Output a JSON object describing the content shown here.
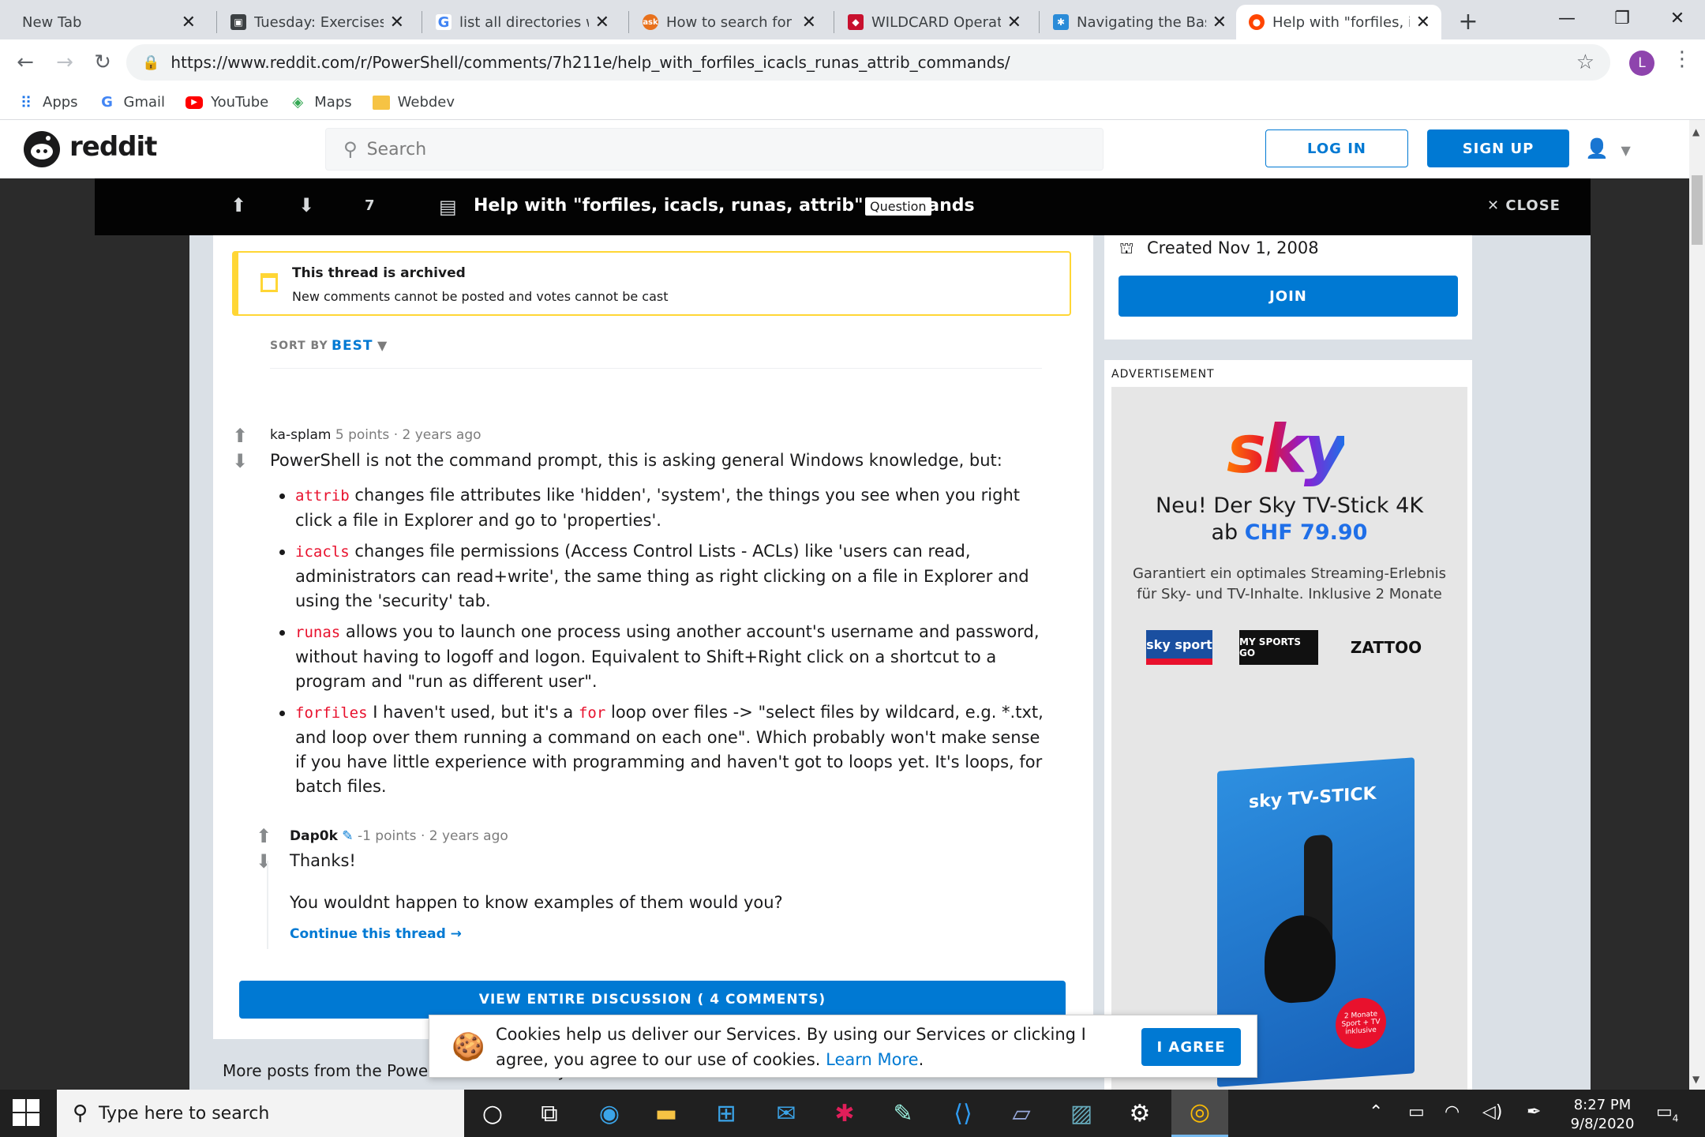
{
  "browser": {
    "tabs": [
      {
        "title": "New Tab",
        "icon": "none",
        "color": ""
      },
      {
        "title": "Tuesday: Exercises C",
        "icon": "doc-icon",
        "color": "#3c4043"
      },
      {
        "title": "list all directories wit",
        "icon": "google-icon",
        "color": "#4285f4"
      },
      {
        "title": "How to search for all",
        "icon": "ask-icon",
        "color": "#e8711c"
      },
      {
        "title": "WILDCARD Operato",
        "icon": "wildcard-icon",
        "color": "#c8102e"
      },
      {
        "title": "Navigating the Bash",
        "icon": "bash-icon",
        "color": "#2a8bd8"
      },
      {
        "title": "Help with \"forfiles, ic",
        "icon": "reddit-icon",
        "color": "#ff4500"
      }
    ],
    "url": "https://www.reddit.com/r/PowerShell/comments/7h211e/help_with_forfiles_icacls_runas_attrib_commands/",
    "profile_initial": "L",
    "bookmarks": [
      {
        "label": "Apps",
        "icon": "apps-grid-icon"
      },
      {
        "label": "Gmail",
        "icon": "google-icon"
      },
      {
        "label": "YouTube",
        "icon": "youtube-icon"
      },
      {
        "label": "Maps",
        "icon": "maps-icon"
      },
      {
        "label": "Webdev",
        "icon": "folder-icon"
      }
    ]
  },
  "reddit": {
    "brand": "reddit",
    "search_placeholder": "Search",
    "login_label": "LOG IN",
    "signup_label": "SIGN UP",
    "post": {
      "score": "7",
      "title": "Help with \"forfiles, icacls, runas, attrib\" commands",
      "flair": "Question",
      "close_label": "CLOSE"
    },
    "archived": {
      "title": "This thread is archived",
      "subtitle": "New comments cannot be posted and votes cannot be cast"
    },
    "sort": {
      "label": "SORT BY",
      "value": "BEST"
    },
    "comments": [
      {
        "author": "ka-splam",
        "points": "5 points",
        "age": "2 years ago",
        "intro": "PowerShell is not the command prompt, this is asking general Windows knowledge, but:",
        "items": [
          {
            "code": "attrib",
            "text": " changes file attributes like 'hidden', 'system', the things you see when you right click a file in Explorer and go to 'properties'."
          },
          {
            "code": "icacls",
            "text": " changes file permissions (Access Control Lists - ACLs) like 'users can read, administrators can read+write', the same thing as right clicking on a file in Explorer and using the 'security' tab."
          },
          {
            "code": "runas",
            "text": " allows you to launch one process using another account's username and password, without having to logoff and logon. Equivalent to Shift+Right click on a shortcut to a program and \"run as different user\"."
          },
          {
            "code": "forfiles",
            "text_a": " I haven't used, but it's a ",
            "code_b": "for",
            "text_b": " loop over files -> \"select files by wildcard, e.g. *.txt, and loop over them running a command on each one\". Which probably won't make sense if you have little experience with programming and haven't got to loops yet. It's loops, for batch files."
          }
        ]
      },
      {
        "author": "Dap0k",
        "points": "-1 points",
        "age": "2 years ago",
        "line1": "Thanks!",
        "line2": "You wouldnt happen to know examples of them would you?",
        "continue": "Continue this thread"
      }
    ],
    "view_all": "VIEW ENTIRE DISCUSSION ( 4 COMMENTS)",
    "more_posts": "More posts from the PowerShell community",
    "sidebar": {
      "created": "Created Nov 1, 2008",
      "join_label": "JOIN",
      "ad_label": "ADVERTISEMENT"
    },
    "ad": {
      "logo": "sky",
      "headline_1": "Neu! Der Sky TV-Stick 4K",
      "headline_2_prefix": "ab ",
      "price": "CHF 79.90",
      "body": "Garantiert ein optimales Streaming-Erlebnis für Sky- und TV-Inhalte. Inklusive 2 Monate",
      "partners": [
        "sky sport",
        "MY SPORTS GO",
        "ZATTOO"
      ],
      "box_label": "sky TV-STICK",
      "badge": "2 Monate Sport + TV inklusive"
    },
    "cookie": {
      "text": "Cookies help us deliver our Services. By using our Services or clicking I agree, you agree to our use of cookies. ",
      "link": "Learn More",
      "button": "I AGREE"
    }
  },
  "taskbar": {
    "search_placeholder": "Type here to search",
    "time": "8:27 PM",
    "date": "9/8/2020",
    "notification_count": "4"
  },
  "colors": {
    "reddit_blue": "#0079d3",
    "archived_yellow": "#ffd635",
    "code_red": "#e8112d"
  }
}
